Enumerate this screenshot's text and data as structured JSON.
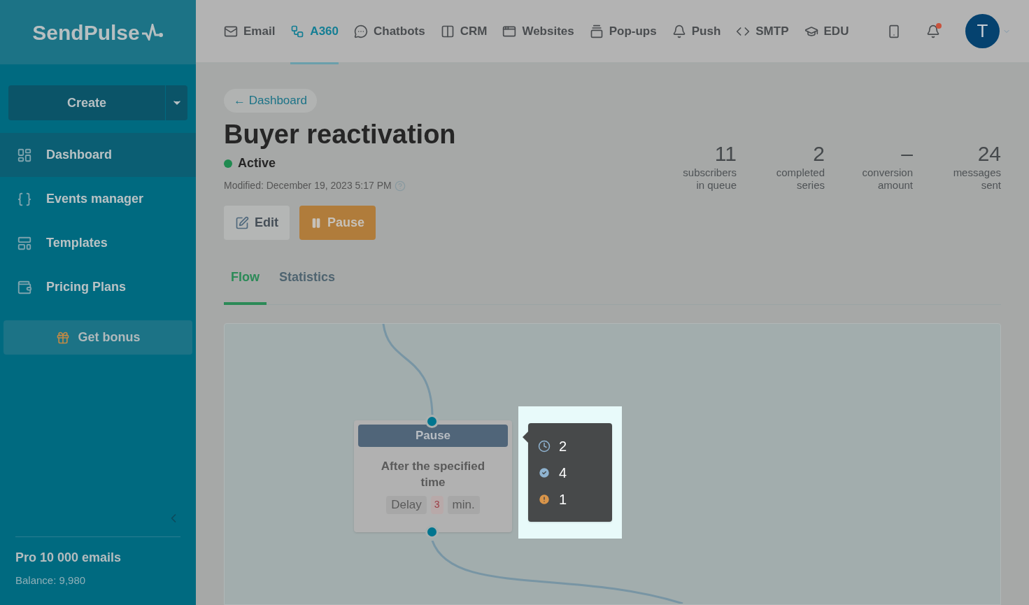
{
  "brand": {
    "name": "SendPulse"
  },
  "top_nav": [
    {
      "label": "Email",
      "kind": "mail",
      "selected": false
    },
    {
      "label": "A360",
      "kind": "flow",
      "selected": true
    },
    {
      "label": "Chatbots",
      "kind": "chat",
      "selected": false
    },
    {
      "label": "CRM",
      "kind": "crm",
      "selected": false
    },
    {
      "label": "Websites",
      "kind": "site",
      "selected": false
    },
    {
      "label": "Pop-ups",
      "kind": "popup",
      "selected": false
    },
    {
      "label": "Push",
      "kind": "bell",
      "selected": false
    },
    {
      "label": "SMTP",
      "kind": "code",
      "selected": false
    },
    {
      "label": "EDU",
      "kind": "edu",
      "selected": false
    }
  ],
  "user": {
    "initial": "T",
    "has_notification": true
  },
  "sidebar": {
    "create_button": "Create",
    "items": [
      {
        "label": "Dashboard",
        "kind": "dashboard",
        "selected": true
      },
      {
        "label": "Events manager",
        "kind": "events",
        "selected": false
      },
      {
        "label": "Templates",
        "kind": "templates",
        "selected": false
      },
      {
        "label": "Pricing Plans",
        "kind": "wallet",
        "selected": false
      }
    ],
    "bonus_button": "Get bonus",
    "plan": {
      "name": "Pro 10 000 emails",
      "balance": "Balance: 9,980"
    }
  },
  "page": {
    "back_link": "← Dashboard",
    "title": "Buyer reactivation",
    "status": {
      "label": "Active",
      "color": "#1f8a50"
    },
    "modified": "Modified: December 19, 2023 5:17 PM",
    "buttons": [
      {
        "label": "Edit",
        "kind": "edit"
      },
      {
        "label": "Pause",
        "kind": "pause"
      }
    ],
    "stats": [
      {
        "value": "11",
        "label": "subscribers in queue"
      },
      {
        "value": "2",
        "label": "completed series"
      },
      {
        "value": "–",
        "label": "conversion amount"
      },
      {
        "value": "24",
        "label": "messages sent"
      }
    ],
    "tabs": [
      {
        "label": "Flow",
        "selected": true
      },
      {
        "label": "Statistics",
        "selected": false
      }
    ]
  },
  "flow": {
    "node": {
      "header": "Pause",
      "text": "After the specified time",
      "delay_label": "Delay",
      "delay_value": "3",
      "delay_unit": "min."
    },
    "tooltip": [
      {
        "kind": "clock",
        "value": "2"
      },
      {
        "kind": "check",
        "value": "4"
      },
      {
        "kind": "warning",
        "value": "1"
      }
    ]
  }
}
